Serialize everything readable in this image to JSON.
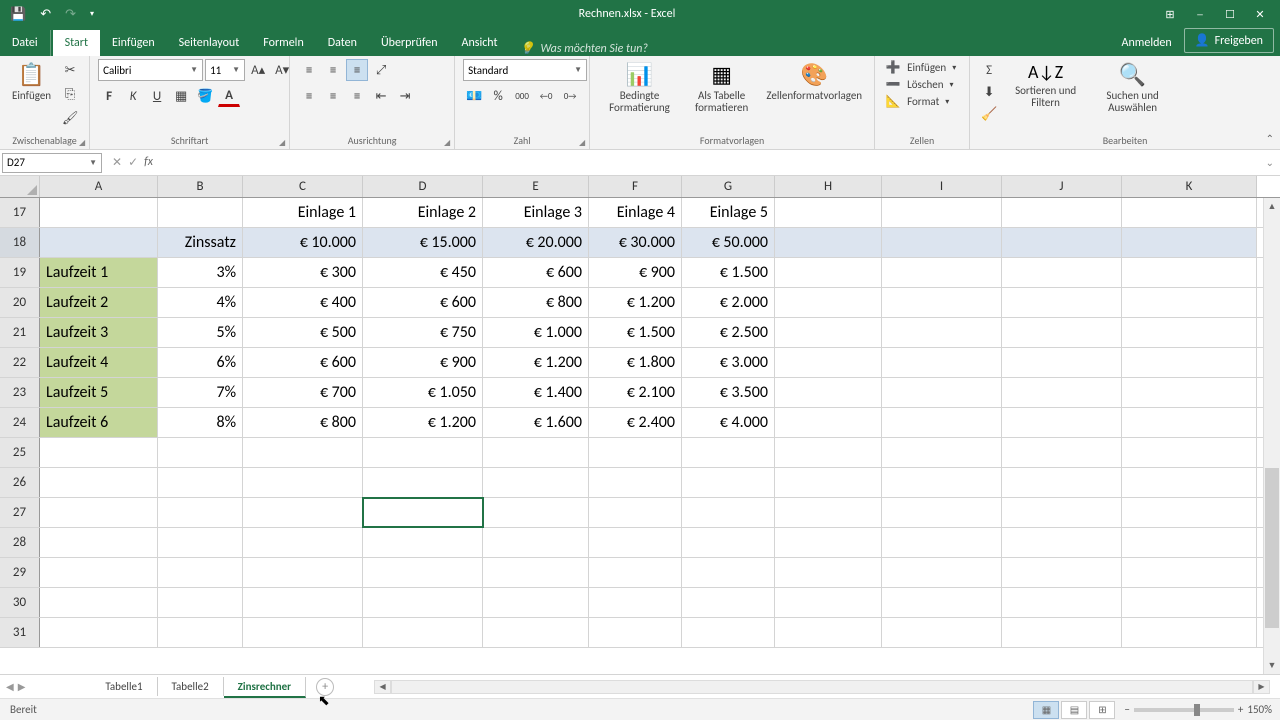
{
  "app": {
    "title": "Rechnen.xlsx - Excel"
  },
  "qat": {
    "save": "💾",
    "undo": "↶",
    "redo": "↷"
  },
  "win": {
    "opts": "⊞",
    "min": "─",
    "max": "☐",
    "close": "✕"
  },
  "tabs": {
    "file": "Datei",
    "home": "Start",
    "insert": "Einfügen",
    "layout": "Seitenlayout",
    "formulas": "Formeln",
    "data": "Daten",
    "review": "Überprüfen",
    "view": "Ansicht",
    "tell": "Was möchten Sie tun?",
    "signin": "Anmelden",
    "share": "Freigeben"
  },
  "ribbon": {
    "clipboard": {
      "paste": "Einfügen",
      "label": "Zwischenablage"
    },
    "font": {
      "name": "Calibri",
      "size": "11",
      "label": "Schriftart"
    },
    "align": {
      "label": "Ausrichtung"
    },
    "number": {
      "format": "Standard",
      "label": "Zahl"
    },
    "styles": {
      "cond": "Bedingte Formatierung",
      "table": "Als Tabelle formatieren",
      "styles": "Zellenformatvorlagen",
      "label": "Formatvorlagen"
    },
    "cells": {
      "insert": "Einfügen",
      "delete": "Löschen",
      "format": "Format",
      "label": "Zellen"
    },
    "editing": {
      "sort": "Sortieren und Filtern",
      "find": "Suchen und Auswählen",
      "label": "Bearbeiten"
    }
  },
  "fbar": {
    "namebox": "D27"
  },
  "cols": [
    "A",
    "B",
    "C",
    "D",
    "E",
    "F",
    "G",
    "H",
    "I",
    "J",
    "K"
  ],
  "rownums": [
    17,
    18,
    19,
    20,
    21,
    22,
    23,
    24,
    25,
    26,
    27,
    28,
    29,
    30,
    31
  ],
  "data": {
    "r17": [
      "",
      "",
      "Einlage 1",
      "Einlage 2",
      "Einlage 3",
      "Einlage 4",
      "Einlage 5"
    ],
    "r18": [
      "",
      "Zinssatz",
      "€ 10.000",
      "€ 15.000",
      "€ 20.000",
      "€ 30.000",
      "€ 50.000"
    ],
    "r19": [
      "Laufzeit 1",
      "3%",
      "€ 300",
      "€ 450",
      "€ 600",
      "€ 900",
      "€ 1.500"
    ],
    "r20": [
      "Laufzeit 2",
      "4%",
      "€ 400",
      "€ 600",
      "€ 800",
      "€ 1.200",
      "€ 2.000"
    ],
    "r21": [
      "Laufzeit 3",
      "5%",
      "€ 500",
      "€ 750",
      "€ 1.000",
      "€ 1.500",
      "€ 2.500"
    ],
    "r22": [
      "Laufzeit 4",
      "6%",
      "€ 600",
      "€ 900",
      "€ 1.200",
      "€ 1.800",
      "€ 3.000"
    ],
    "r23": [
      "Laufzeit 5",
      "7%",
      "€ 700",
      "€ 1.050",
      "€ 1.400",
      "€ 2.100",
      "€ 3.500"
    ],
    "r24": [
      "Laufzeit 6",
      "8%",
      "€ 800",
      "€ 1.200",
      "€ 1.600",
      "€ 2.400",
      "€ 4.000"
    ]
  },
  "sheets": {
    "t1": "Tabelle1",
    "t2": "Tabelle2",
    "t3": "Zinsrechner"
  },
  "status": {
    "ready": "Bereit",
    "zoom": "150%"
  }
}
